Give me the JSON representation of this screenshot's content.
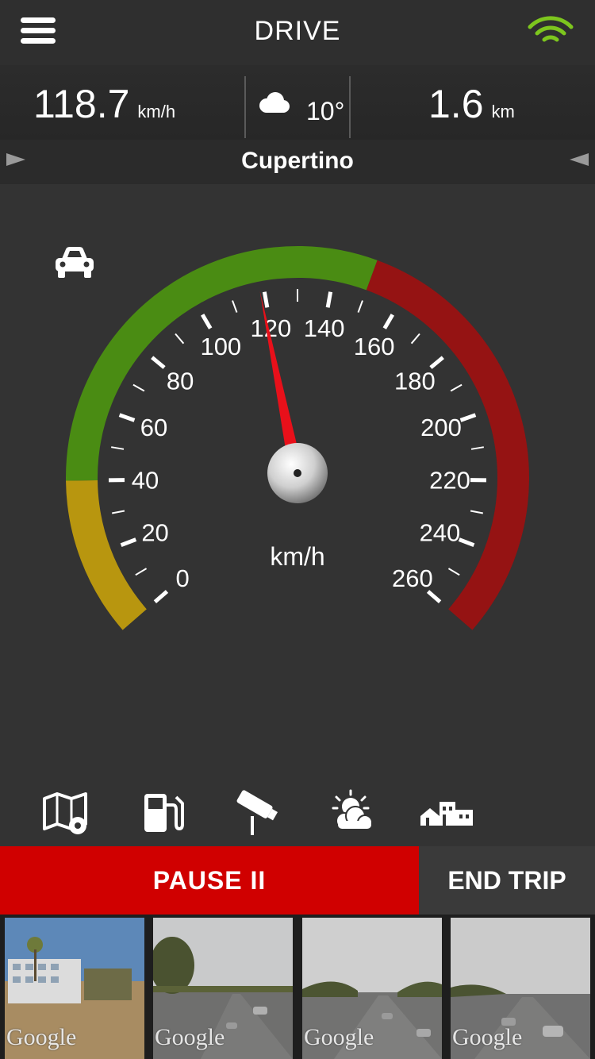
{
  "header": {
    "title": "DRIVE",
    "menu_icon": "hamburger-menu-icon",
    "signal_icon": "wifi-signal-icon",
    "signal_color": "#7dc61e"
  },
  "stats": {
    "speed_value": "118.7",
    "speed_unit": "km/h",
    "weather_icon": "cloud-icon",
    "temperature": "10°",
    "distance_value": "1.6",
    "distance_unit": "km"
  },
  "location": {
    "name": "Cupertino"
  },
  "speedometer": {
    "unit": "km/h",
    "current_speed": 118.7,
    "min": 0,
    "max": 260,
    "tick_labels": [
      "0",
      "20",
      "40",
      "60",
      "80",
      "100",
      "120",
      "140",
      "160",
      "180",
      "200",
      "220",
      "240",
      "260"
    ],
    "zones": [
      {
        "name": "low",
        "from": 0,
        "to": 40,
        "color": "#b8960f"
      },
      {
        "name": "normal",
        "from": 40,
        "to": 150,
        "color": "#4a8c13"
      },
      {
        "name": "high",
        "from": 150,
        "to": 260,
        "color": "#951313"
      }
    ],
    "needle_color": "#e8101a",
    "vehicle_icon": "car-icon"
  },
  "toolbar": {
    "icons": [
      "map-pin-icon",
      "fuel-pump-icon",
      "speed-camera-icon",
      "weather-sun-cloud-icon",
      "buildings-icon"
    ]
  },
  "actions": {
    "pause_label": "PAUSE  II",
    "end_label": "END TRIP",
    "pause_color": "#d00000"
  },
  "thumbnails": [
    {
      "watermark": "Google"
    },
    {
      "watermark": "Google"
    },
    {
      "watermark": "Google"
    },
    {
      "watermark": "Google"
    }
  ]
}
